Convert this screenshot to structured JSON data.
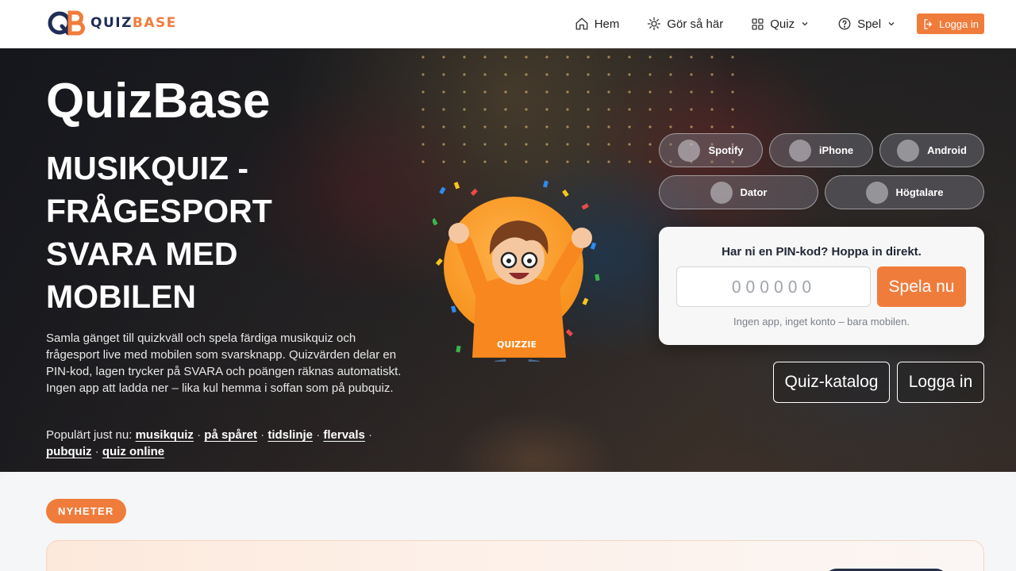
{
  "brand": {
    "logo_text_a": "QUIZ",
    "logo_text_b": "BASE",
    "colors": {
      "navy": "#1f2d55",
      "orange": "#f07c3c"
    }
  },
  "nav": {
    "items": [
      {
        "label": "Hem",
        "icon": "home-icon"
      },
      {
        "label": "Gör så här",
        "icon": "sun-icon"
      },
      {
        "label": "Quiz",
        "icon": "grid-icon",
        "dropdown": true
      },
      {
        "label": "Spel",
        "icon": "help-circle-icon",
        "dropdown": true
      }
    ],
    "login_label": "Logga in"
  },
  "hero": {
    "title": "QuizBase",
    "subtitle": "MUSIKQUIZ - FRÅGESPORT SVARA MED MOBILEN",
    "description": "Samla gänget till quizkväll och spela färdiga musikquiz och frågesport live med mobilen som svarsknapp. Quizvärden delar en PIN-kod, lagen trycker på SVARA och poängen räknas automatiskt. Ingen app att ladda ner – lika kul hemma i soffan som på pubquiz.",
    "popular_label": "Populärt just nu:",
    "popular_links": [
      "musikquiz",
      "på spåret",
      "tidslinje",
      "flervals",
      "pubquiz",
      "quiz online"
    ],
    "mascot_label": "QUIZZIE"
  },
  "devices": [
    "Spotify",
    "iPhone",
    "Android",
    "Dator",
    "Högtalare"
  ],
  "pin": {
    "heading": "Har ni en PIN-kod? Hoppa in direkt.",
    "placeholder": "000000",
    "button": "Spela nu",
    "note": "Ingen app, inget konto – bara mobilen."
  },
  "actions": {
    "catalog": "Quiz-katalog",
    "login": "Logga in"
  },
  "news": {
    "badge": "NYHETER"
  }
}
